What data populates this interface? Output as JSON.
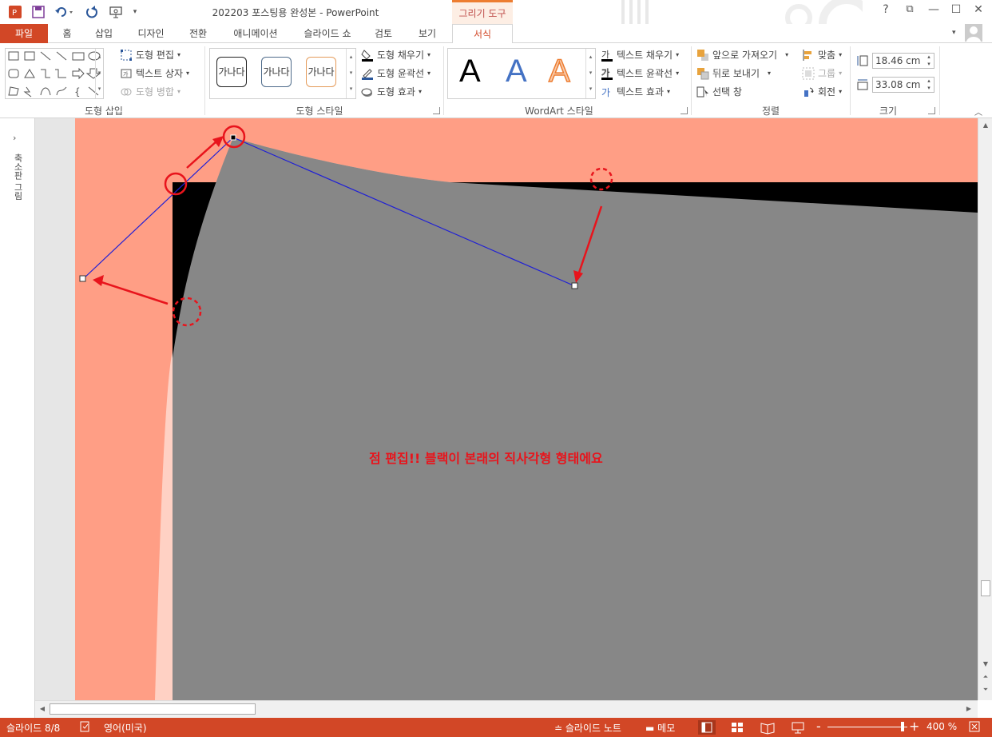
{
  "window": {
    "title": "202203 포스팅용 완성본 - PowerPoint",
    "contextual_tab_label": "그리기 도구",
    "help": "?",
    "restore_ribbon": "⧉",
    "minimize": "—",
    "maximize": "☐",
    "close": "✕"
  },
  "tabs": [
    "파일",
    "홈",
    "삽입",
    "디자인",
    "전환",
    "애니메이션",
    "슬라이드 쇼",
    "검토",
    "보기",
    "서식"
  ],
  "ribbon": {
    "insert_shapes": {
      "label": "도형 삽입",
      "edit_shape": "도형 편집",
      "text_box": "텍스트 상자",
      "merge_shapes": "도형 병합"
    },
    "shape_styles": {
      "label": "도형 스타일",
      "thumb_text": "가나다",
      "fill": "도형 채우기",
      "outline": "도형 윤곽선",
      "effects": "도형 효과"
    },
    "wordart": {
      "label": "WordArt 스타일",
      "letter": "A",
      "text_fill": "텍스트 채우기",
      "text_outline": "텍스트 윤곽선",
      "text_effects": "텍스트 효과"
    },
    "arrange": {
      "label": "정렬",
      "bring_forward": "앞으로 가져오기",
      "send_backward": "뒤로 보내기",
      "selection_pane": "선택 창",
      "align": "맞춤",
      "group": "그룹",
      "rotate": "회전"
    },
    "size": {
      "label": "크기",
      "height": "18.46 cm",
      "width": "33.08 cm"
    }
  },
  "left_panel": {
    "thumbnails_label": "축소판 그림",
    "expand": "›"
  },
  "slide": {
    "annotation_text": "점 편집!! 블랙이 본래의 직사각형 형태에요",
    "colors": {
      "background": "#ff9e85",
      "light_shape": "#ffd1c4",
      "black_shape": "#000000",
      "gray_shape": "#878787",
      "handle_line": "#1f1fd6",
      "annotation": "#e8141c"
    }
  },
  "status_bar": {
    "slide_info": "슬라이드 8/8",
    "language": "영어(미국)",
    "notes": "슬라이드 노트",
    "comments": "메모",
    "zoom": "400 %",
    "zoom_minus": "-",
    "zoom_plus": "+"
  },
  "icons": {
    "app": "powerpoint-icon",
    "save": "save-icon",
    "undo": "undo-icon",
    "redo": "redo-icon",
    "present": "present-icon"
  }
}
